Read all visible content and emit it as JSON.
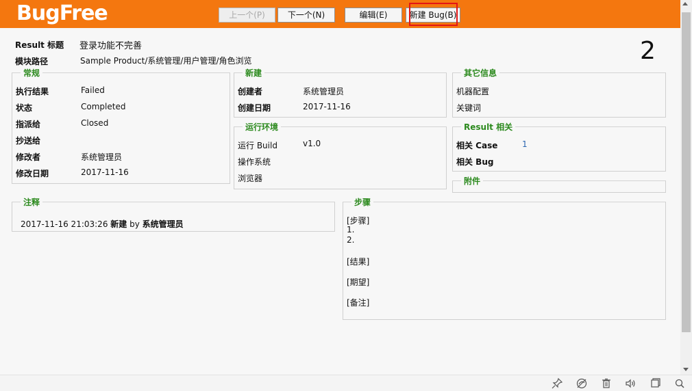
{
  "header": {
    "logo": "BugFree",
    "buttons": {
      "prev": "上一个(P)",
      "next": "下一个(N)",
      "edit": "编辑(E)",
      "new_bug": "新建 Bug(B)"
    }
  },
  "record": {
    "id": "2",
    "title_label": "Result 标题",
    "title_value": "登录功能不完善",
    "module_label": "模块路径",
    "module_value": "Sample Product/系统管理/用户管理/角色浏览"
  },
  "general": {
    "title": "常规",
    "rows": [
      {
        "label": "执行结果",
        "value": "Failed"
      },
      {
        "label": "状态",
        "value": "Completed"
      },
      {
        "label": "指派给",
        "value": "Closed"
      },
      {
        "label": "抄送给",
        "value": ""
      },
      {
        "label": "修改者",
        "value": "系统管理员"
      },
      {
        "label": "修改日期",
        "value": "2017-11-16"
      }
    ]
  },
  "created": {
    "title": "新建",
    "rows": [
      {
        "label": "创建者",
        "value": "系统管理员"
      },
      {
        "label": "创建日期",
        "value": "2017-11-16"
      }
    ]
  },
  "environment": {
    "title": "运行环境",
    "rows": [
      {
        "label": "运行 Build",
        "value": "v1.0"
      },
      {
        "label": "操作系统",
        "value": ""
      },
      {
        "label": "浏览器",
        "value": ""
      }
    ]
  },
  "other": {
    "title": "其它信息",
    "rows": [
      {
        "label": "机器配置",
        "value": ""
      },
      {
        "label": "关键词",
        "value": ""
      }
    ]
  },
  "related": {
    "title": "Result 相关",
    "rows": [
      {
        "label": "相关 Case",
        "value": "1"
      },
      {
        "label": "相关 Bug",
        "value": ""
      }
    ]
  },
  "attachments": {
    "title": "附件"
  },
  "notes": {
    "title": "注释",
    "entry_time": "2017-11-16 21:03:26",
    "entry_action": "新建",
    "entry_by": "by",
    "entry_user": "系统管理员"
  },
  "steps": {
    "title": "步骤",
    "lines": [
      "[步骤]",
      "1.",
      "2.",
      "[结果]",
      "[期望]",
      "[备注]"
    ]
  },
  "colors": {
    "header": "#f4770f",
    "section_title": "#2c8a1e",
    "highlight": "#e31515",
    "link": "#2a65b0"
  }
}
